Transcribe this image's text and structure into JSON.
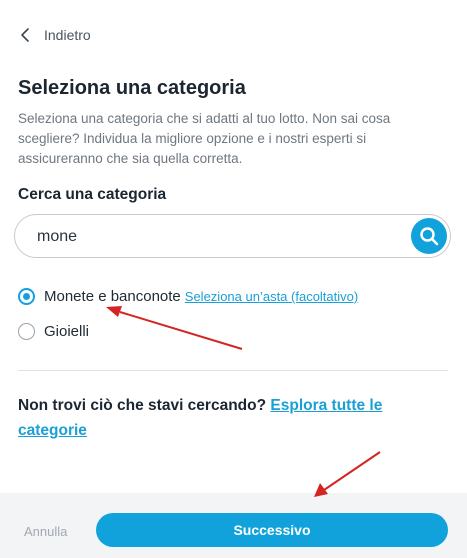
{
  "nav": {
    "back_label": "Indietro"
  },
  "header": {
    "title": "Seleziona una categoria",
    "description": "Seleziona una categoria che si adatti al tuo lotto. Non sai cosa scegliere? Individua la migliore opzione e i nostri esperti si assicureranno che sia quella corretta."
  },
  "search": {
    "label": "Cerca una categoria",
    "value": "mone"
  },
  "options": [
    {
      "label": "Monete e banconote",
      "link": "Seleziona un’asta (facoltativo)",
      "selected": true
    },
    {
      "label": "Gioielli",
      "selected": false
    }
  ],
  "not_found": {
    "text": "Non trovi ciò che stavi cercando?",
    "link": "Esplora tutte le categorie"
  },
  "footer": {
    "cancel_label": "Annulla",
    "next_label": "Successivo"
  },
  "colors": {
    "accent": "#12a2db",
    "annotation_arrow": "#d42424"
  }
}
